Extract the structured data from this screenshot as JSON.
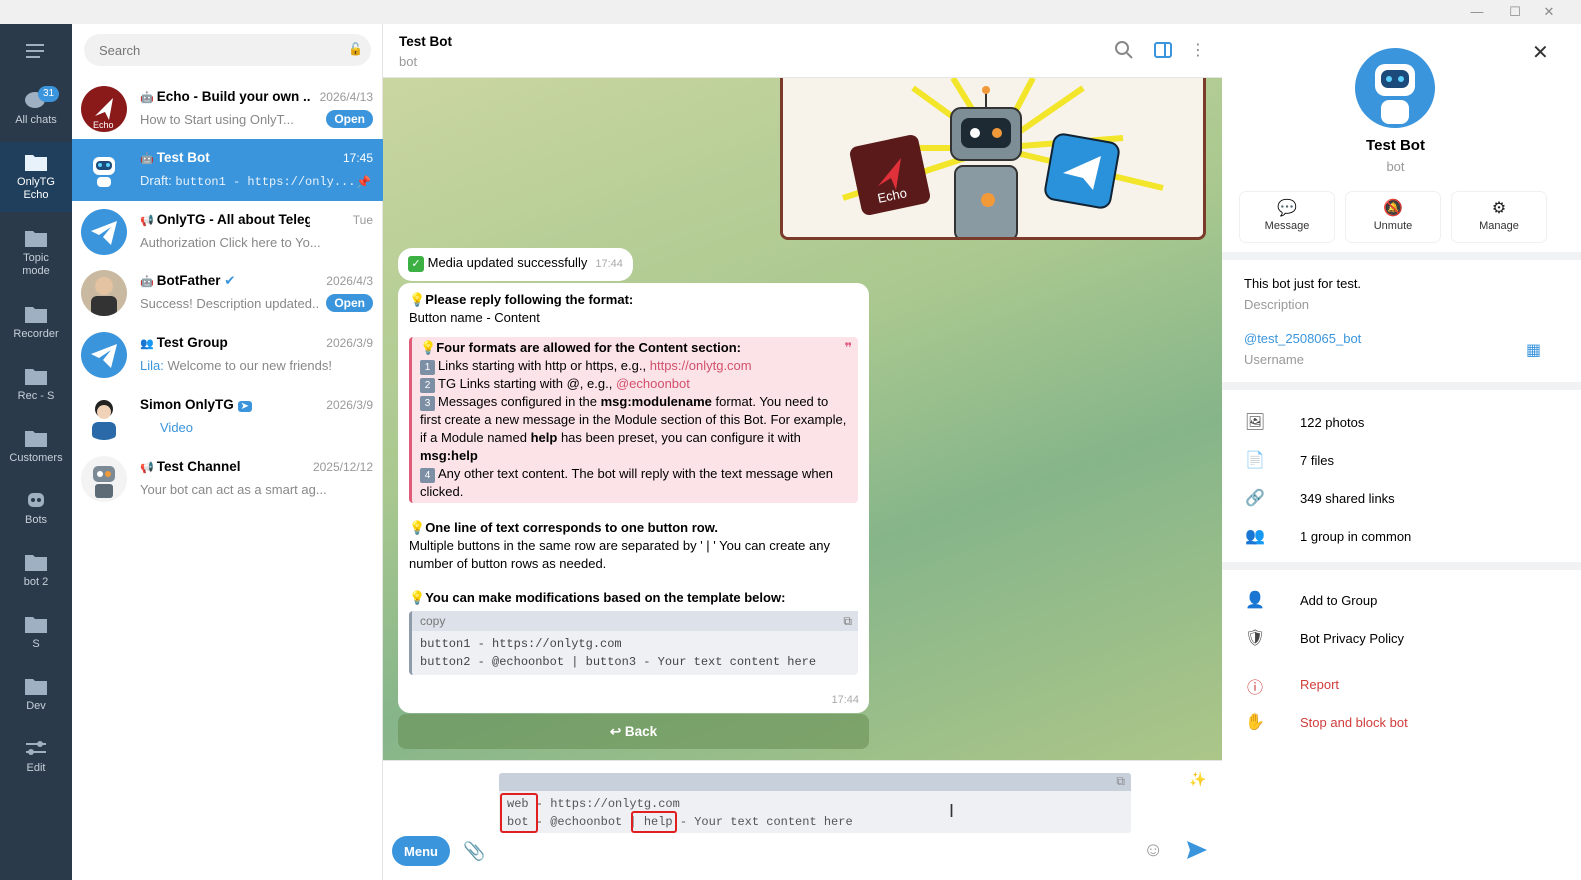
{
  "folders": [
    {
      "label": "All chats",
      "badge": "31"
    },
    {
      "label": "OnlyTG Echo"
    },
    {
      "label": "Topic mode"
    },
    {
      "label": "Recorder"
    },
    {
      "label": "Rec - S"
    },
    {
      "label": "Customers"
    },
    {
      "label": "Bots"
    },
    {
      "label": "bot 2"
    },
    {
      "label": "S"
    },
    {
      "label": "Dev"
    },
    {
      "label": "Edit"
    }
  ],
  "search": {
    "placeholder": "Search"
  },
  "chats": [
    {
      "name": "Echo - Build your own ...",
      "time": "2026/4/13",
      "preview": "How to Start using OnlyT...",
      "open": "Open"
    },
    {
      "name": "Test Bot",
      "time": "17:45",
      "preview_prefix": "Draft:",
      "preview": "button1 - https://only..."
    },
    {
      "name": "OnlyTG - All about Telegram",
      "time": "Tue",
      "preview": "Authorization Click here to Yo..."
    },
    {
      "name": "BotFather",
      "time": "2026/4/3",
      "preview": "Success! Description updated...",
      "open": "Open"
    },
    {
      "name": "Test Group",
      "time": "2026/3/9",
      "preview_sender": "Lila:",
      "preview": "Welcome to our new friends!"
    },
    {
      "name": "Simon OnlyTG",
      "time": "2026/3/9",
      "preview": "Video"
    },
    {
      "name": "Test Channel",
      "time": "2025/12/12",
      "preview": "Your bot can act as a smart ag..."
    }
  ],
  "header": {
    "title": "Test Bot",
    "subtitle": "bot"
  },
  "media": {
    "logo_text": "Echo"
  },
  "toast": {
    "text": "Media updated successfully",
    "time": "17:44"
  },
  "message": {
    "h1": "Please reply following the format:",
    "l1": "Button name - Content",
    "q_title": "Four formats are allowed for the Content section:",
    "q1a": "Links starting with http or https, e.g.,",
    "q1b": "https://onlytg.com",
    "q2a": "TG Links starting with @, e.g.,",
    "q2b": "@echoonbot",
    "q3a": "Messages configured in the",
    "q3b": "msg:modulename",
    "q3c": "format. You need to first create a new message in the Module section of this Bot. For example, if a Module named",
    "q3d": "help",
    "q3e": "has been preset, you can configure it with",
    "q3f": "msg:help",
    "q4": "Any other text content. The bot will reply with the text message when clicked.",
    "h2": "One line of text corresponds to one button row.",
    "l2": "Multiple buttons in the same row are separated by ' | ' You can create any number of button rows as needed.",
    "h3": "You can make modifications based on the template below:",
    "code_label": "copy",
    "code1": "button1 - https://onlytg.com",
    "code2": "button2 - @echoonbot | button3 - Your text content here",
    "time": "17:44"
  },
  "back_button": "Back",
  "composer": {
    "line1": "web - https://onlytg.com",
    "line2": "bot - @echoonbot | help - Your text content here",
    "menu": "Menu"
  },
  "profile": {
    "name": "Test Bot",
    "sub": "bot",
    "actions": [
      "Message",
      "Unmute",
      "Manage"
    ],
    "description": "This bot just for test.",
    "description_label": "Description",
    "username": "@test_2508065_bot",
    "username_label": "Username",
    "stats": [
      "122 photos",
      "7 files",
      "349 shared links",
      "1 group in common"
    ],
    "add_group": "Add to Group",
    "privacy": "Bot Privacy Policy",
    "report": "Report",
    "stop": "Stop and block bot"
  },
  "colors": {
    "accent": "#3a95dc",
    "folder_bg": "#2b3a4a",
    "danger": "#d03b3b"
  }
}
